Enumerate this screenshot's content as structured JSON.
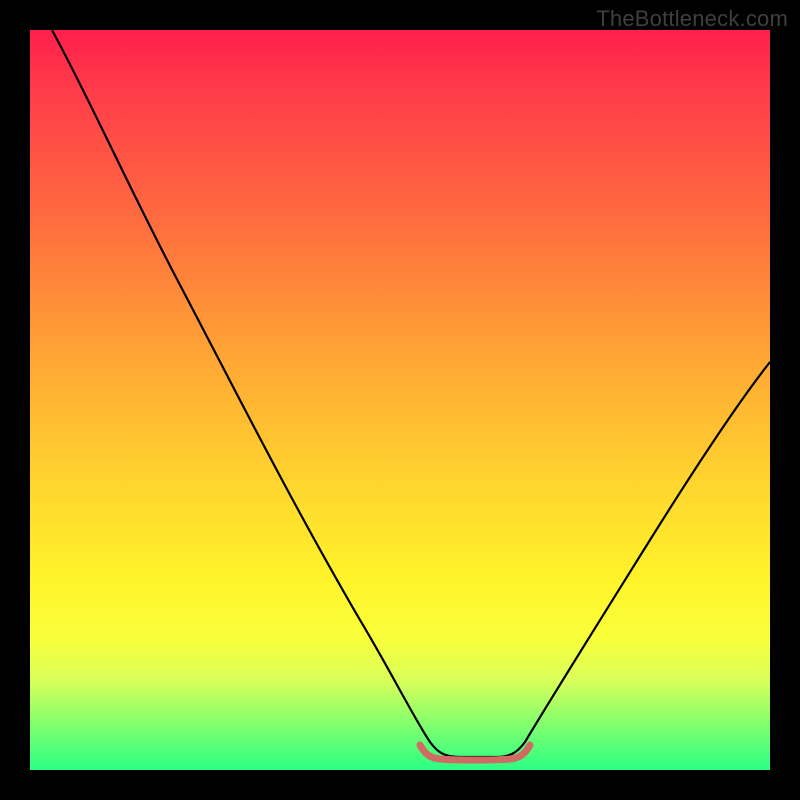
{
  "watermark": "TheBottleneck.com",
  "chart_data": {
    "type": "line",
    "title": "",
    "xlabel": "",
    "ylabel": "",
    "xlim": [
      0,
      100
    ],
    "ylim": [
      0,
      100
    ],
    "grid": false,
    "legend": false,
    "series": [
      {
        "name": "bottleneck-curve",
        "color": "#000000",
        "x": [
          3,
          10,
          20,
          30,
          40,
          48,
          52,
          55,
          58,
          60,
          63,
          66,
          70,
          80,
          90,
          100
        ],
        "y": [
          100,
          88,
          73,
          57,
          40,
          23,
          12,
          5,
          2,
          2,
          2,
          5,
          12,
          28,
          42,
          55
        ]
      },
      {
        "name": "valley-highlight",
        "color": "#d16a62",
        "x": [
          52,
          55,
          58,
          60,
          63,
          66
        ],
        "y": [
          4,
          2,
          1.5,
          1.5,
          2,
          4
        ]
      }
    ],
    "background_gradient": {
      "top": "#ff1f4b",
      "mid": "#ffd72e",
      "bottom": "#2bff84"
    }
  }
}
